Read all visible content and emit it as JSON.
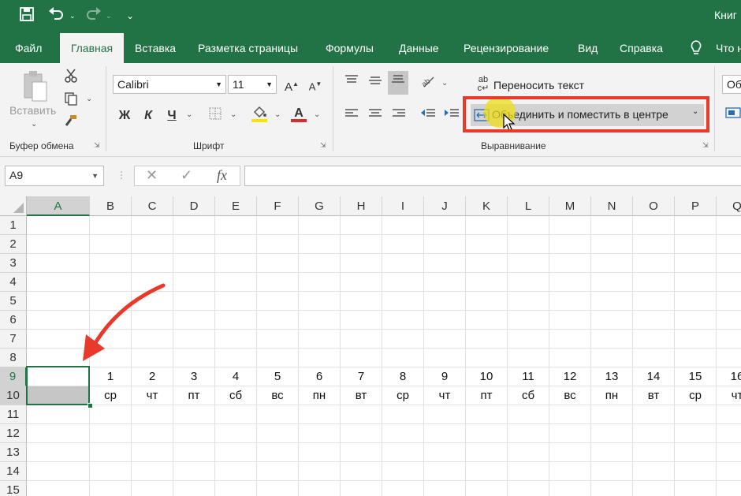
{
  "titlebar": {
    "title": "Книг"
  },
  "tabs": [
    "Файл",
    "Главная",
    "Вставка",
    "Разметка страницы",
    "Формулы",
    "Данные",
    "Рецензирование",
    "Вид",
    "Справка",
    "Что н"
  ],
  "clipboard": {
    "paste_label": "Вставить",
    "group_label": "Буфер обмена"
  },
  "font": {
    "name": "Calibri",
    "size": "11",
    "bold": "Ж",
    "italic": "К",
    "underline": "Ч",
    "group_label": "Шрифт"
  },
  "alignment": {
    "wrap_label": "Переносить текст",
    "merge_label": "Объединить и поместить в центре",
    "group_label": "Выравнивание",
    "partial_label": "Об"
  },
  "formula_bar": {
    "name_box": "A9",
    "fx": "fx",
    "formula": ""
  },
  "grid": {
    "columns": [
      "A",
      "B",
      "C",
      "D",
      "E",
      "F",
      "G",
      "H",
      "I",
      "J",
      "K",
      "L",
      "M",
      "N",
      "O",
      "P",
      "Q"
    ],
    "rows": [
      "1",
      "2",
      "3",
      "4",
      "5",
      "6",
      "7",
      "8",
      "9",
      "10",
      "11",
      "12",
      "13",
      "14",
      "15"
    ],
    "row9": [
      "",
      "1",
      "2",
      "3",
      "4",
      "5",
      "6",
      "7",
      "8",
      "9",
      "10",
      "11",
      "12",
      "13",
      "14",
      "15",
      "16"
    ],
    "row10": [
      "",
      "ср",
      "чт",
      "пт",
      "сб",
      "вс",
      "пн",
      "вт",
      "ср",
      "чт",
      "пт",
      "сб",
      "вс",
      "пн",
      "вт",
      "ср",
      "чт"
    ],
    "selected_cell": "A9"
  },
  "colors": {
    "excel_green": "#217346",
    "highlight_red": "#e8392a",
    "cursor_yellow": "#f3e21a"
  }
}
